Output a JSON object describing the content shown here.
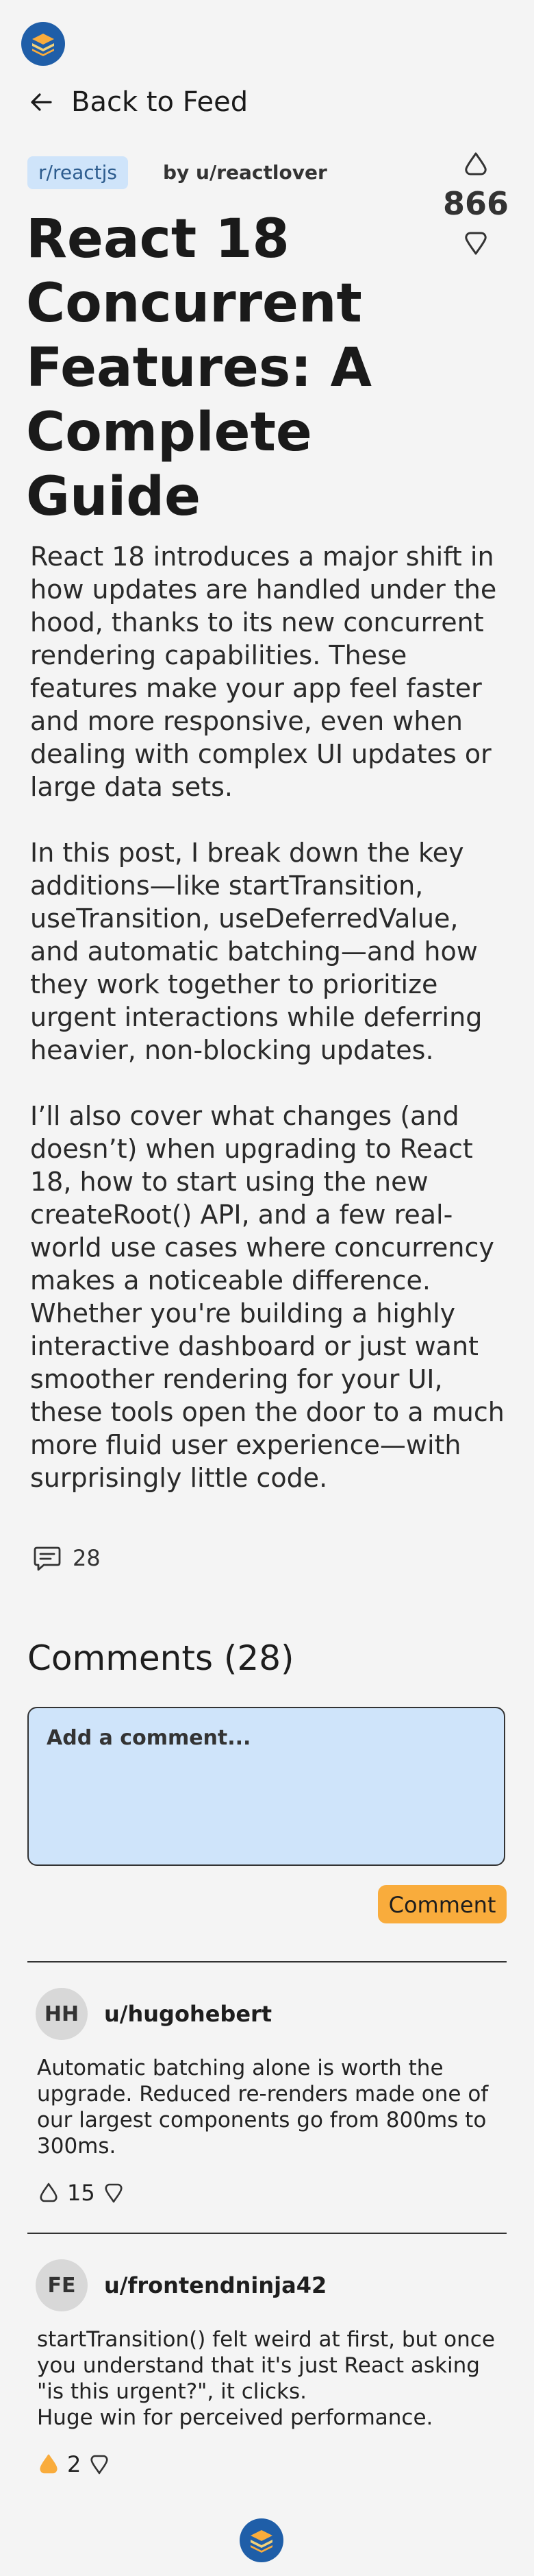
{
  "back": {
    "label": "Back to Feed"
  },
  "post": {
    "subreddit": "r/reactjs",
    "author": "by u/reactlover",
    "votes": "866",
    "title": "React 18 Concurrent Features: A Complete Guide",
    "paragraphs": [
      "React 18 introduces a major shift in how updates are handled under the hood, thanks to its new concurrent rendering capabilities. These features make your app feel faster and more responsive, even when dealing with complex UI updates or large data sets.",
      "In this post, I break down the key additions—like startTransition, useTransition, useDeferredValue, and automatic batching—and how they work together to prioritize urgent interactions while deferring heavier, non-blocking updates.",
      "I’ll also cover what changes (and doesn’t) when upgrading to React 18, how to start using the new createRoot() API, and a few real-world use cases where concurrency makes a noticeable difference. Whether you're building a highly interactive dashboard or just want smoother rendering for your UI, these tools open the door to a much more fluid user experience—with surprisingly little code."
    ],
    "comment_count": "28"
  },
  "comments_section": {
    "heading": "Comments (28)",
    "placeholder": "Add a comment...",
    "submit_label": "Comment"
  },
  "comments": [
    {
      "initials": "HH",
      "user": "u/hugohebert",
      "text": "Automatic batching alone is worth the upgrade. Reduced re-renders made one of our largest components go from 800ms to 300ms.",
      "votes": "15",
      "upvoted": false
    },
    {
      "initials": "FE",
      "user": "u/frontendninja42",
      "text": "startTransition() felt weird at first, but once you understand that it's just React asking \"is this urgent?\", it clicks.\nHuge win for perceived performance.",
      "votes": "2",
      "upvoted": true
    }
  ],
  "colors": {
    "accent": "#f9ac3c",
    "pill_bg": "#cfe4fa",
    "logo_bg": "#1f5ea8"
  }
}
